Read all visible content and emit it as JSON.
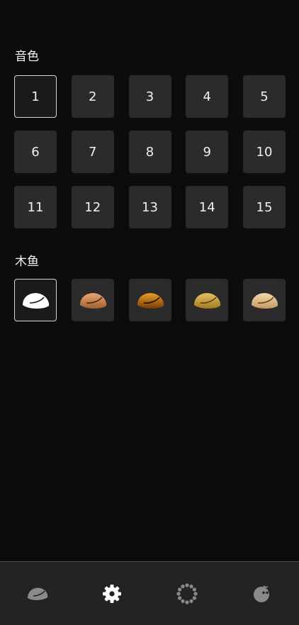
{
  "sections": {
    "timbre": {
      "title": "音色",
      "items": [
        "1",
        "2",
        "3",
        "4",
        "5",
        "6",
        "7",
        "8",
        "9",
        "10",
        "11",
        "12",
        "13",
        "14",
        "15"
      ],
      "selected": "1"
    },
    "woodfish": {
      "title": "木鱼",
      "styles": [
        "white-woodfish-icon",
        "light-wood-woodfish-icon",
        "dark-wood-woodfish-icon",
        "gold-woodfish-icon",
        "beige-woodfish-icon"
      ],
      "selected_index": 0
    }
  },
  "tabbar": {
    "tabs": [
      {
        "icon": "woodfish-icon",
        "active": false
      },
      {
        "icon": "gear-icon",
        "active": true
      },
      {
        "icon": "prayer-beads-icon",
        "active": false
      },
      {
        "icon": "face-icon",
        "active": false
      }
    ]
  },
  "colors": {
    "background": "#0c0c0c",
    "tile": "#2b2b2b",
    "tabbar": "#232323",
    "selected_border": "#d6d6d6"
  }
}
